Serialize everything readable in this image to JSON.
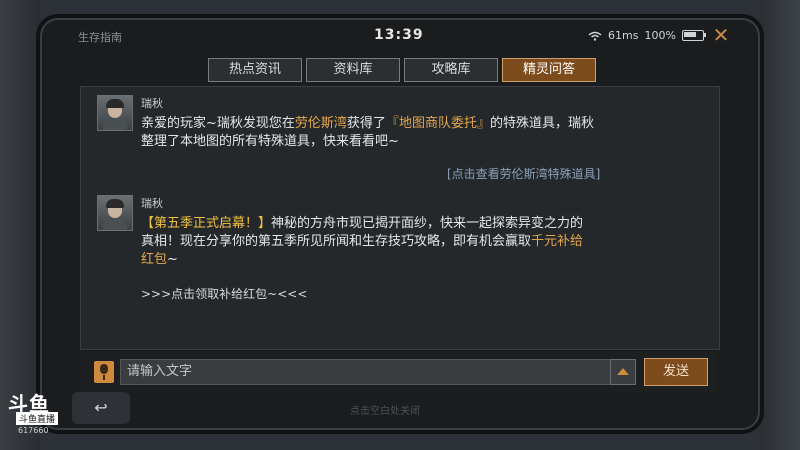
{
  "topbar": {
    "app_title": "生存指南",
    "clock": "13:39",
    "network": "61ms",
    "battery": "100%",
    "close_label": "✕"
  },
  "tabs": [
    {
      "label": "热点资讯",
      "active": false
    },
    {
      "label": "资料库",
      "active": false
    },
    {
      "label": "攻略库",
      "active": false
    },
    {
      "label": "精灵问答",
      "active": true
    }
  ],
  "messages": [
    {
      "sender": "瑞秋",
      "text_1": "亲爱的玩家~瑞秋发现您在",
      "hl_1": "劳伦斯湾",
      "text_2": "获得了",
      "hl_2": "『地图商队委托』",
      "text_3": "的特殊道具，瑞秋",
      "line2": "整理了本地图的所有特殊道具，快来看看吧~",
      "link": "[点击查看劳伦斯湾特殊道具]"
    },
    {
      "sender": "瑞秋",
      "hl_1": "【第五季正式启幕！】",
      "text_1": "神秘的方舟市现已揭开面纱，快来一起探索异变之力的",
      "line2_a": "真相！现在分享你的第五季所见所闻和生存技巧攻略，即有机会赢取",
      "hl_2": "千元补给",
      "line3": "红包",
      "line3_tail": "~",
      "link": ">>>点击领取补给红包~<<<"
    }
  ],
  "input": {
    "placeholder": "请输入文字"
  },
  "send_label": "发送",
  "bottom": {
    "logo_text": "斗鱼",
    "logo_sub": "斗鱼直播",
    "logo_num": "617660",
    "back_symbol": "↩",
    "hint": "点击空白处关闭"
  },
  "colors": {
    "accent": "#7e4b1c",
    "highlight": "#e4a64d",
    "highlight_yellow": "#f0c140",
    "link": "#8aa0b8"
  }
}
